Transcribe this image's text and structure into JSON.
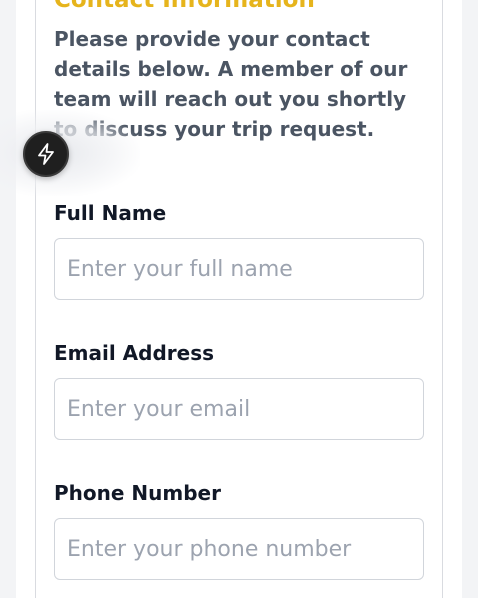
{
  "section": {
    "title": "Contact Information",
    "description": "Please provide your contact details below. A member of our team will reach out you shortly to discuss your trip request."
  },
  "fields": {
    "full_name": {
      "label": "Full Name",
      "placeholder": "Enter your full name",
      "value": ""
    },
    "email": {
      "label": "Email Address",
      "placeholder": "Enter your email",
      "value": ""
    },
    "phone": {
      "label": "Phone Number",
      "placeholder": "Enter your phone number",
      "value": ""
    }
  },
  "floating_button": {
    "icon": "lightning-bolt-icon"
  },
  "colors": {
    "accent": "#e6b41c",
    "text_muted": "#4b5563",
    "text_strong": "#111827",
    "placeholder": "#9ca3af",
    "border": "#d1d5db"
  }
}
